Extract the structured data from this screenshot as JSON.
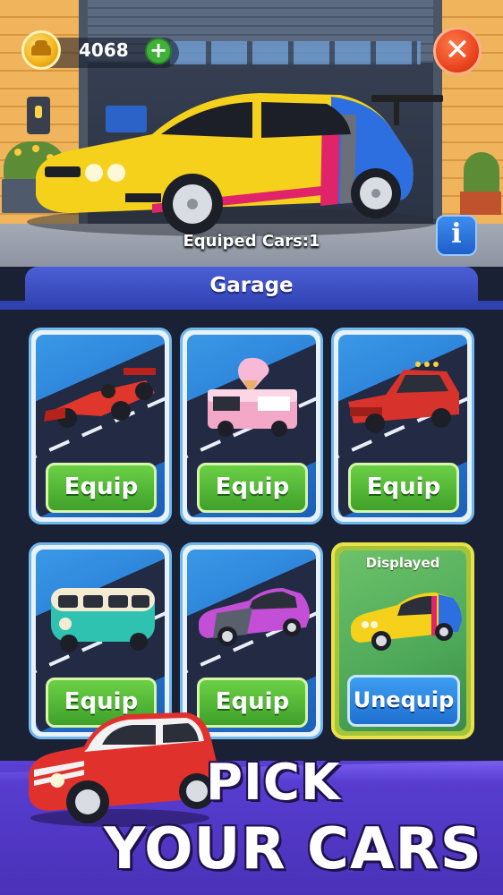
{
  "hud": {
    "coins": "4068",
    "plus_label": "+",
    "close_label": "✕",
    "info_label": "i"
  },
  "hero": {
    "equipped_text": "Equiped Cars:1",
    "car_color": "#f5d11c"
  },
  "garage": {
    "title": "Garage",
    "cards": [
      {
        "car": "red formula racer",
        "button": "Equip",
        "body_color": "#e0362c"
      },
      {
        "car": "ice cream truck",
        "button": "Equip",
        "body_color": "#f2a8c6"
      },
      {
        "car": "red pickup truck",
        "button": "Equip",
        "body_color": "#d7322c"
      },
      {
        "car": "teal camper van",
        "button": "Equip",
        "body_color": "#2fc2b0"
      },
      {
        "car": "purple sports car",
        "button": "Equip",
        "body_color": "#c34fd6"
      },
      {
        "car": "yellow sports car",
        "button": "Unequip",
        "status": "Displayed",
        "body_color": "#f5d11c"
      }
    ]
  },
  "promo": {
    "line1": "PICK",
    "line2": "YOUR CARS"
  },
  "colors": {
    "equip_green": "#4fb532",
    "unequip_blue": "#2b85e0",
    "tab_blue": "#3d50c8",
    "banner_purple": "#5138c8"
  }
}
